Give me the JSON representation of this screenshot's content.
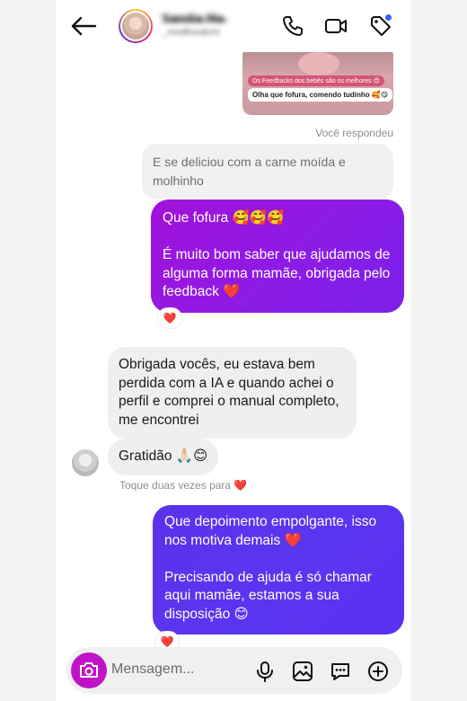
{
  "header": {
    "contact_name": "S̶a̶n̶d̶i̶a̶ M̶a̶",
    "contact_handle": "_modlosaluni"
  },
  "story_reply": {
    "caption": "Os Feedbacks dos bebês são os melhores 😍",
    "text": "Olha que fofura, comendo tudinho 🥰😋",
    "replied_label": "Você respondeu"
  },
  "messages": {
    "quoted": "E se deliciou com a carne moída e molhinho",
    "out1": "Que fofura 🥰🥰🥰\n\nÉ muito bom saber que ajudamos de alguma forma mamãe, obrigada pelo feedback ❤️",
    "in1": "Obrigada vocês, eu estava bem perdida com a IA e quando achei o perfil e comprei o manual completo, me encontrei",
    "in2": "Gratidão 🙏🏻😊",
    "hint": "Toque duas vezes para ❤️",
    "out2": "Que depoimento empolgante, isso nos motiva demais ❤️\n\nPrecisando de ajuda é só chamar aqui mamãe, estamos a sua disposição 😊",
    "reaction": "❤️"
  },
  "composer": {
    "placeholder": "Mensagem..."
  },
  "colors": {
    "outgoing_purple": "#9417e2",
    "outgoing_blue": "#5b33ee",
    "incoming_gray": "#efefef",
    "camera": "#c013c8"
  }
}
